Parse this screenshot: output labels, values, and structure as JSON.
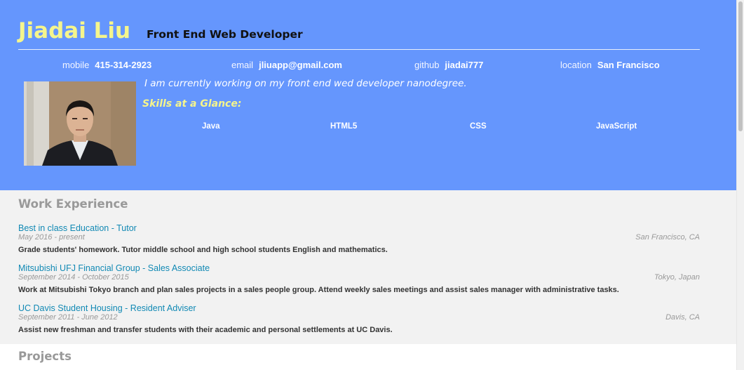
{
  "header": {
    "name": "Jiadai Liu",
    "role": "Front End Web Developer",
    "contacts": [
      {
        "label": "mobile",
        "value": "415-314-2923"
      },
      {
        "label": "email",
        "value": "jliuapp@gmail.com"
      },
      {
        "label": "github",
        "value": "jiadai777"
      },
      {
        "label": "location",
        "value": "San Francisco"
      }
    ],
    "welcome": "I am currently working on my front end wed developer nanodegree.",
    "skills_heading": "Skills at a Glance:",
    "skills": [
      "Java",
      "HTML5",
      "CSS",
      "JavaScript"
    ]
  },
  "work": {
    "title": "Work Experience",
    "jobs": [
      {
        "title": "Best in class Education - Tutor",
        "dates": "May 2016 - present",
        "location": "San Francisco, CA",
        "description": "Grade students' homework. Tutor middle school and high school students English and mathematics."
      },
      {
        "title": "Mitsubishi UFJ Financial Group - Sales Associate",
        "dates": "September 2014 - October 2015",
        "location": "Tokyo, Japan",
        "description": "Work at Mitsubishi Tokyo branch and plan sales projects in a sales people group. Attend weekly sales meetings and assist sales manager with administrative tasks."
      },
      {
        "title": "UC Davis Student Housing - Resident Adviser",
        "dates": "September 2011 - June 2012",
        "location": "Davis, CA",
        "description": "Assist new freshman and transfer students with their academic and personal settlements at UC Davis."
      }
    ]
  },
  "projects": {
    "title": "Projects"
  },
  "colors": {
    "header_bg": "#6596fd",
    "name_yellow": "#f5f58c",
    "link_blue": "#1189b4",
    "section_gray": "#999999",
    "work_bg": "#f2f2f2"
  }
}
